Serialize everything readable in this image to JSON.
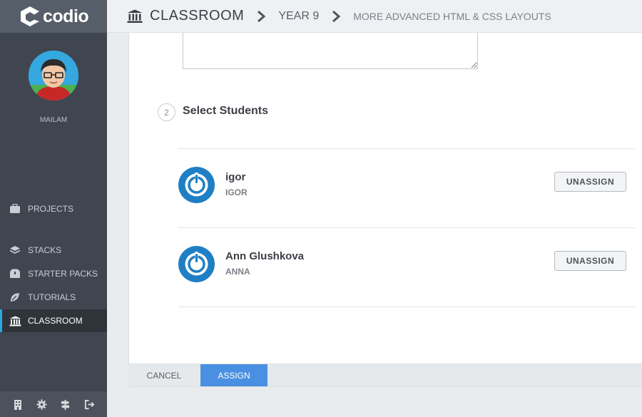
{
  "app": {
    "logo_text": "codio"
  },
  "user": {
    "name": "MAILAM"
  },
  "nav": {
    "items": [
      {
        "label": "PROJECTS",
        "icon": "briefcase-icon"
      },
      {
        "label": "STACKS",
        "icon": "layers-icon"
      },
      {
        "label": "STARTER PACKS",
        "icon": "box-icon"
      },
      {
        "label": "TUTORIALS",
        "icon": "tutorial-icon"
      },
      {
        "label": "CLASSROOM",
        "icon": "classroom-icon",
        "active": true
      }
    ]
  },
  "breadcrumb": {
    "items": [
      "CLASSROOM",
      "YEAR 9",
      "MORE ADVANCED HTML & CSS LAYOUTS"
    ]
  },
  "step": {
    "number": "2",
    "title": "Select Students"
  },
  "students": [
    {
      "name": "igor",
      "username": "IGOR",
      "action": "UNASSIGN"
    },
    {
      "name": "Ann Glushkova",
      "username": "ANNA",
      "action": "UNASSIGN"
    }
  ],
  "footer": {
    "cancel_label": "CANCEL",
    "assign_label": "ASSIGN"
  },
  "colors": {
    "sidebar": "#3f4650",
    "accent": "#2aa6e0",
    "assign": "#4a90e2",
    "avatar": "#1f7fc4"
  }
}
